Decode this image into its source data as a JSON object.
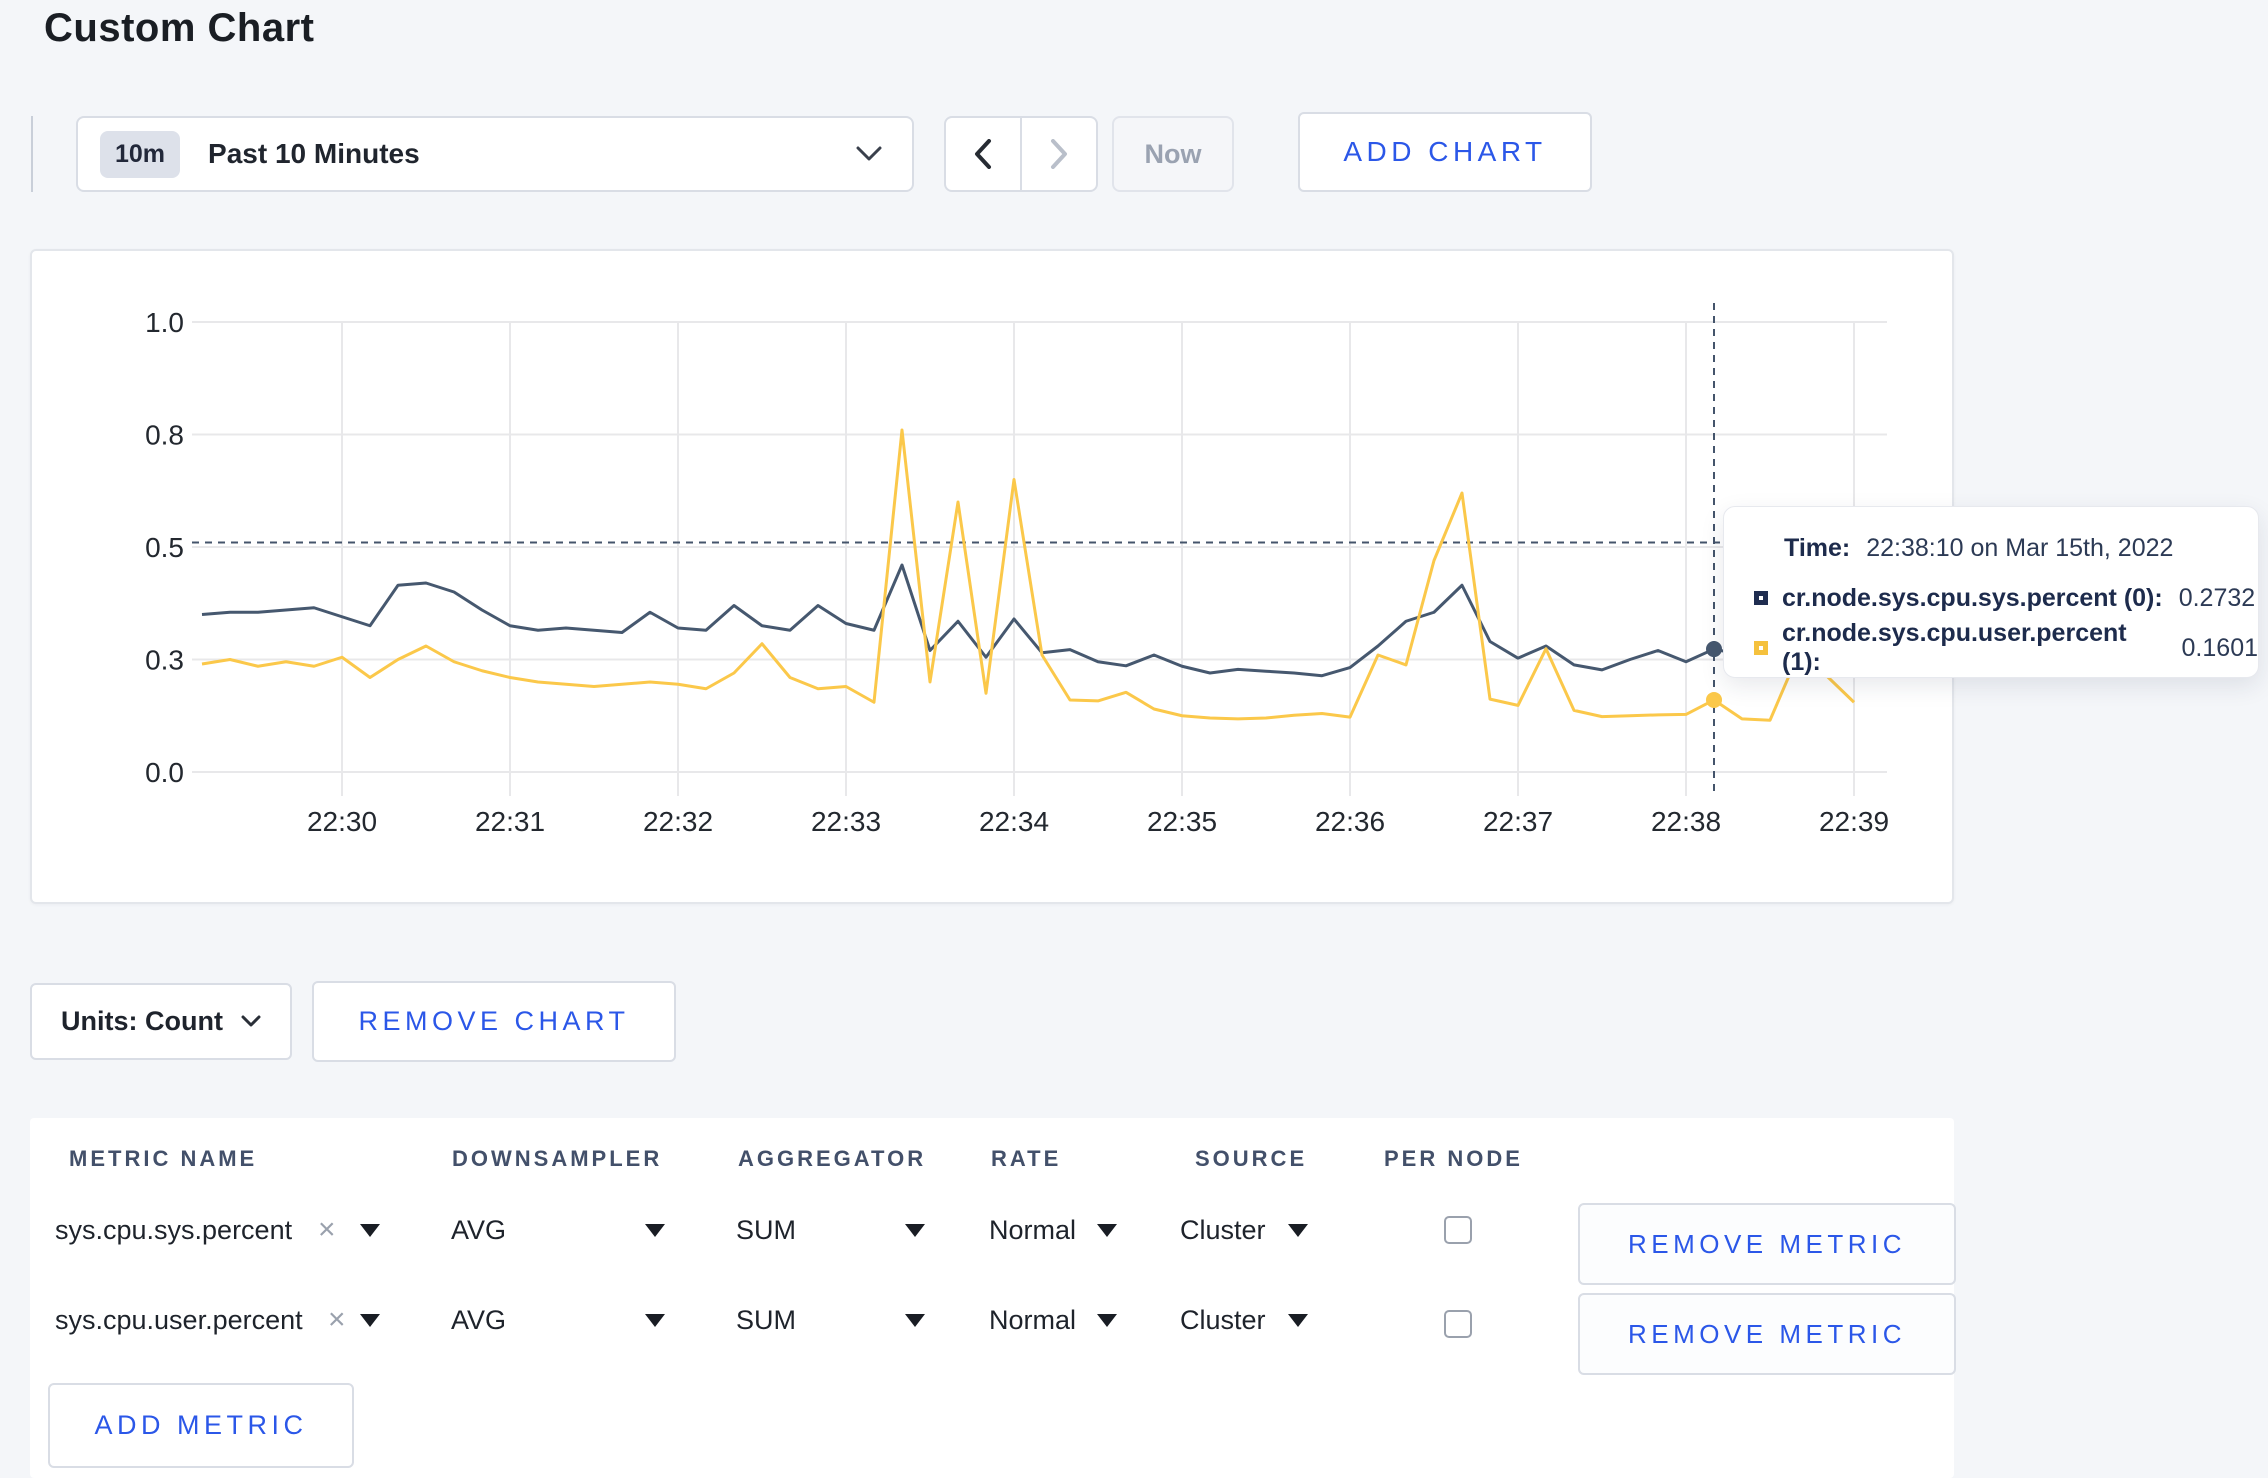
{
  "page": {
    "title": "Custom Chart"
  },
  "toolbar": {
    "time_range_badge": "10m",
    "time_range_label": "Past 10 Minutes",
    "now_button": "Now",
    "add_chart_button": "ADD CHART"
  },
  "chart_controls": {
    "units_button": "Units: Count",
    "remove_chart_button": "REMOVE CHART"
  },
  "tooltip": {
    "time_label": "Time:",
    "time_value": "22:38:10 on Mar 15th, 2022",
    "series": [
      {
        "name": "cr.node.sys.cpu.sys.percent (0):",
        "value": "0.2732",
        "swatch_color": "#1f2d50"
      },
      {
        "name": "cr.node.sys.cpu.user.percent (1):",
        "value": "0.1601",
        "swatch_color": "#f5c13d"
      }
    ]
  },
  "chart_data": {
    "type": "line",
    "title": "",
    "xlabel": "",
    "ylabel": "",
    "x_start": "22:29:10",
    "x_interval_seconds": 10,
    "x_tick_labels": [
      "22:30",
      "22:31",
      "22:32",
      "22:33",
      "22:34",
      "22:35",
      "22:36",
      "22:37",
      "22:38",
      "22:39"
    ],
    "y_tick_labels": [
      "0.0",
      "0.3",
      "0.5",
      "0.8",
      "1.0"
    ],
    "y_tick_values": [
      0,
      0.25,
      0.5,
      0.75,
      1
    ],
    "ylim": [
      0,
      1
    ],
    "grid": true,
    "legend_position": "tooltip",
    "series": [
      {
        "name": "cr.node.sys.cpu.sys.percent (0)",
        "color": "#46586f",
        "values": [
          0.35,
          0.355,
          0.355,
          0.36,
          0.365,
          0.345,
          0.325,
          0.415,
          0.42,
          0.4,
          0.36,
          0.325,
          0.315,
          0.32,
          0.315,
          0.31,
          0.355,
          0.32,
          0.315,
          0.37,
          0.325,
          0.315,
          0.37,
          0.33,
          0.315,
          0.46,
          0.27,
          0.335,
          0.255,
          0.34,
          0.265,
          0.272,
          0.245,
          0.236,
          0.26,
          0.235,
          0.22,
          0.228,
          0.224,
          0.22,
          0.214,
          0.232,
          0.28,
          0.335,
          0.355,
          0.415,
          0.29,
          0.253,
          0.28,
          0.238,
          0.227,
          0.25,
          0.27,
          0.245,
          0.2732,
          0.26,
          0.27,
          0.3,
          0.31,
          0.3
        ]
      },
      {
        "name": "cr.node.sys.cpu.user.percent (1)",
        "color": "#fbc84a",
        "values": [
          0.24,
          0.25,
          0.235,
          0.245,
          0.235,
          0.255,
          0.21,
          0.25,
          0.28,
          0.245,
          0.225,
          0.21,
          0.2,
          0.195,
          0.19,
          0.195,
          0.2,
          0.195,
          0.185,
          0.22,
          0.285,
          0.21,
          0.185,
          0.19,
          0.155,
          0.76,
          0.2,
          0.6,
          0.175,
          0.65,
          0.26,
          0.16,
          0.158,
          0.177,
          0.14,
          0.125,
          0.12,
          0.118,
          0.12,
          0.126,
          0.13,
          0.122,
          0.26,
          0.238,
          0.47,
          0.62,
          0.162,
          0.148,
          0.274,
          0.137,
          0.123,
          0.125,
          0.127,
          0.128,
          0.1601,
          0.118,
          0.115,
          0.26,
          0.215,
          0.155
        ]
      }
    ],
    "crosshair": {
      "time": "22:38:10",
      "index": 54,
      "hline_value": 0.51,
      "points": [
        {
          "series": 0,
          "value": 0.2732
        },
        {
          "series": 1,
          "value": 0.1601
        }
      ]
    }
  },
  "metrics_table": {
    "headers": [
      "METRIC NAME",
      "DOWNSAMPLER",
      "AGGREGATOR",
      "RATE",
      "SOURCE",
      "PER NODE"
    ],
    "remove_x_icon": "×",
    "rows": [
      {
        "metric": "sys.cpu.sys.percent",
        "downsampler": "AVG",
        "aggregator": "SUM",
        "rate": "Normal",
        "source": "Cluster",
        "per_node_checked": false,
        "remove_button": "REMOVE METRIC"
      },
      {
        "metric": "sys.cpu.user.percent",
        "downsampler": "AVG",
        "aggregator": "SUM",
        "rate": "Normal",
        "source": "Cluster",
        "per_node_checked": false,
        "remove_button": "REMOVE METRIC"
      }
    ],
    "add_metric_button": "ADD METRIC"
  },
  "colors": {
    "accent_blue": "#2b57e8",
    "grid": "#e8e8ea",
    "crosshair": "#44546b"
  }
}
